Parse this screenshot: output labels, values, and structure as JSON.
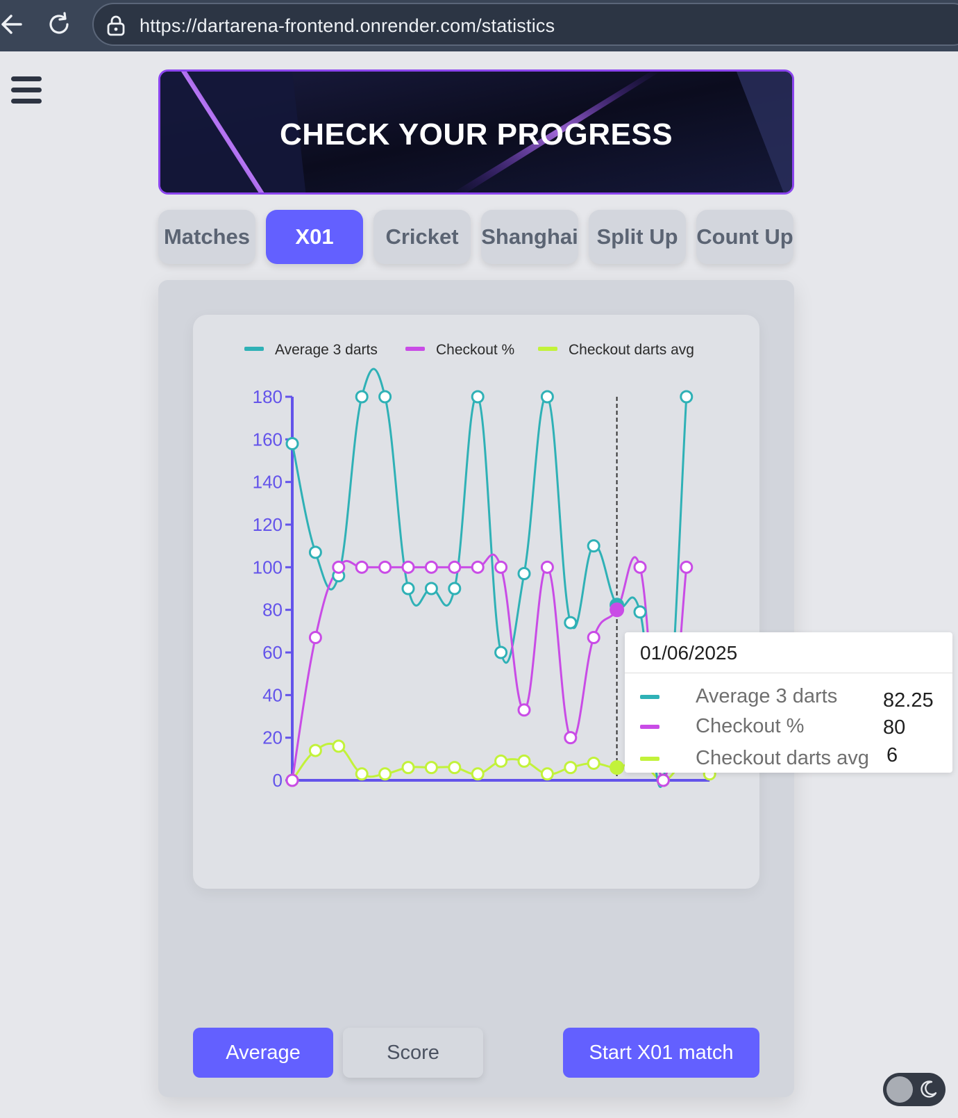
{
  "browser": {
    "url": "https://dartarena-frontend.onrender.com/statistics"
  },
  "banner": {
    "title": "CHECK YOUR PROGRESS"
  },
  "tabs": [
    {
      "label": "Matches",
      "active": false
    },
    {
      "label": "X01",
      "active": true
    },
    {
      "label": "Cricket",
      "active": false
    },
    {
      "label": "Shanghai",
      "active": false
    },
    {
      "label": "Split Up",
      "active": false
    },
    {
      "label": "Count Up",
      "active": false
    }
  ],
  "colors": {
    "accent": "#6360ff",
    "axis": "#6353ea",
    "average": "#2fb1b6",
    "checkout_pct": "#c94ce6",
    "checkout_darts": "#c2f23a"
  },
  "chart_data": {
    "type": "line",
    "ylim": [
      0,
      180
    ],
    "y_ticks": [
      "0",
      "20",
      "40",
      "60",
      "80",
      "100",
      "120",
      "140",
      "160",
      "180"
    ],
    "legend_position": "top",
    "grid": false,
    "series": [
      {
        "name": "Average 3 darts",
        "values": [
          158,
          107,
          96,
          180,
          180,
          90,
          90,
          90,
          180,
          60,
          97,
          180,
          74,
          110,
          82.25,
          79,
          0,
          180
        ]
      },
      {
        "name": "Checkout %",
        "values": [
          0,
          67,
          100,
          100,
          100,
          100,
          100,
          100,
          100,
          100,
          33,
          100,
          20,
          67,
          80,
          100,
          0,
          100
        ]
      },
      {
        "name": "Checkout darts avg",
        "values": [
          0,
          14,
          16,
          3,
          3,
          6,
          6,
          6,
          3,
          9,
          9,
          3,
          6,
          8,
          6,
          9,
          0,
          9,
          3
        ]
      }
    ],
    "highlight_index": 14
  },
  "tooltip": {
    "date": "01/06/2025",
    "rows": [
      {
        "label": "Average 3 darts",
        "value": "82.25"
      },
      {
        "label": "Checkout %",
        "value": "80"
      },
      {
        "label": "Checkout darts avg",
        "value": "6"
      }
    ]
  },
  "buttons": {
    "average": "Average",
    "score": "Score",
    "start": "Start X01 match"
  },
  "icons": {
    "back": "arrow-left-icon",
    "reload": "reload-icon",
    "lock": "lock-icon",
    "menu": "hamburger-icon",
    "theme": "moon-icon"
  }
}
